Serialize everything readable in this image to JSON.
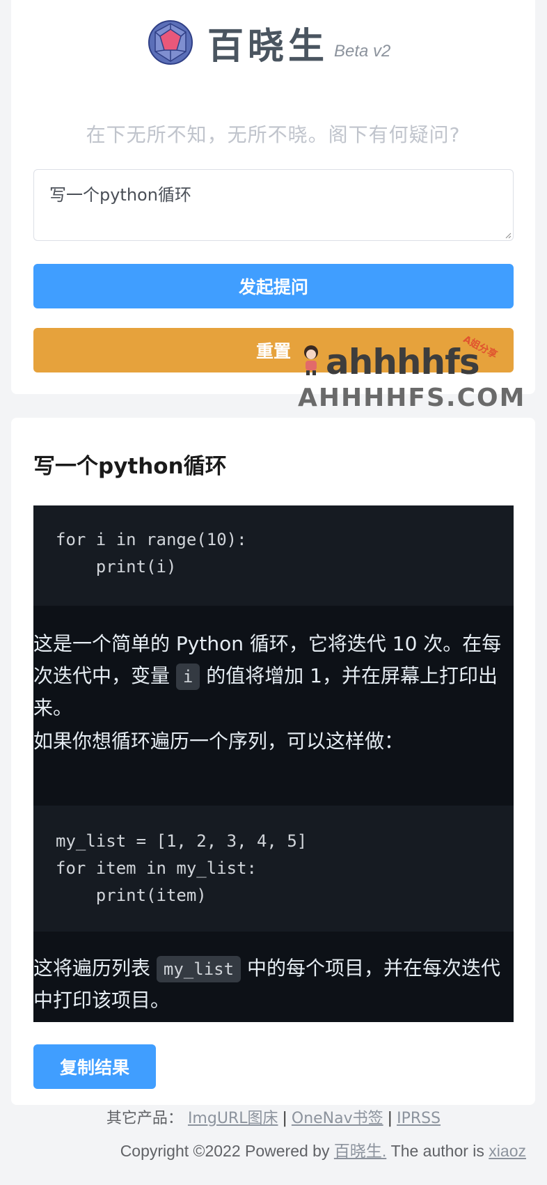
{
  "brand": {
    "title": "百晓生",
    "badge": "Beta v2",
    "tagline": "在下无所不知，无所不晓。阁下有何疑问?"
  },
  "form": {
    "question_value": "写一个python循环",
    "submit_label": "发起提问",
    "reset_label": "重置"
  },
  "watermark": {
    "logo_text": "ahhhhfs",
    "badge_text": "A姐分享",
    "domain": "AHHHHFS.COM"
  },
  "answer": {
    "title": "写一个python循环",
    "code1": "for i in range(10):\n    print(i)",
    "para1_before": "这是一个简单的 Python 循环，它将迭代 10 次。在每次迭代中，变量 ",
    "para1_code": "i",
    "para1_after": " 的值将增加 1，并在屏幕上打印出来。",
    "para2": "如果你想循环遍历一个序列，可以这样做：",
    "code2": "my_list = [1, 2, 3, 4, 5]\nfor item in my_list:\n    print(item)",
    "para3_before": "这将遍历列表 ",
    "para3_code": "my_list",
    "para3_after": " 中的每个项目，并在每次迭代中打印该项目。",
    "copy_label": "复制结果"
  },
  "footer": {
    "products_label": "其它产品：",
    "links": [
      "ImgURL图床",
      "OneNav书签",
      "IPRSS"
    ],
    "separator": "|",
    "copyright_prefix": "Copyright ©2022 Powered by ",
    "powered_link": "百晓生.",
    "author_prefix": " The author is ",
    "author_link": "xiaoz"
  },
  "colors": {
    "primary": "#409eff",
    "warning": "#e6a23c",
    "code_bg": "#161b22",
    "answer_bg": "#0d1117"
  }
}
